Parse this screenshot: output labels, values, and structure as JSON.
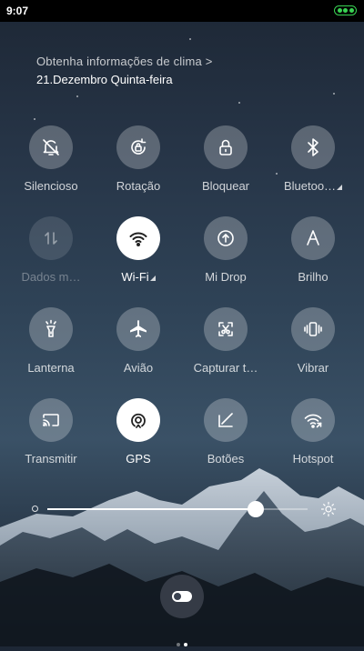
{
  "status_bar": {
    "time": "9:07",
    "battery_icon": "battery-charging-icon",
    "battery_color": "#39d353"
  },
  "weather": {
    "info_text": "Obtenha informações de clima >",
    "date_text": "21.Dezembro  Quinta-feira"
  },
  "tiles": [
    {
      "label": "Silencioso",
      "icon": "bell-off-icon",
      "state": "off"
    },
    {
      "label": "Rotação",
      "icon": "rotation-lock-icon",
      "state": "off"
    },
    {
      "label": "Bloquear",
      "icon": "lock-icon",
      "state": "off"
    },
    {
      "label": "Bluetoo…",
      "icon": "bluetooth-icon",
      "state": "off",
      "has_submenu": true
    },
    {
      "label": "Dados m…",
      "icon": "mobile-data-icon",
      "state": "disabled"
    },
    {
      "label": "Wi-Fi",
      "icon": "wifi-icon",
      "state": "on",
      "has_submenu": true
    },
    {
      "label": "Mi Drop",
      "icon": "mi-drop-icon",
      "state": "off"
    },
    {
      "label": "Brilho",
      "icon": "auto-brightness-icon",
      "state": "off"
    },
    {
      "label": "Lanterna",
      "icon": "flashlight-icon",
      "state": "off"
    },
    {
      "label": "Avião",
      "icon": "airplane-icon",
      "state": "off"
    },
    {
      "label": "Capturar t…",
      "icon": "screenshot-icon",
      "state": "off"
    },
    {
      "label": "Vibrar",
      "icon": "vibrate-icon",
      "state": "off"
    },
    {
      "label": "Transmitir",
      "icon": "cast-icon",
      "state": "off"
    },
    {
      "label": "GPS",
      "icon": "gps-icon",
      "state": "on"
    },
    {
      "label": "Botões",
      "icon": "buttons-icon",
      "state": "off"
    },
    {
      "label": "Hotspot",
      "icon": "hotspot-icon",
      "state": "off"
    }
  ],
  "brightness": {
    "level_percent": 80
  },
  "bottom": {
    "toggle_icon": "toggle-switch-icon",
    "page_count": 2,
    "current_page": 2
  }
}
